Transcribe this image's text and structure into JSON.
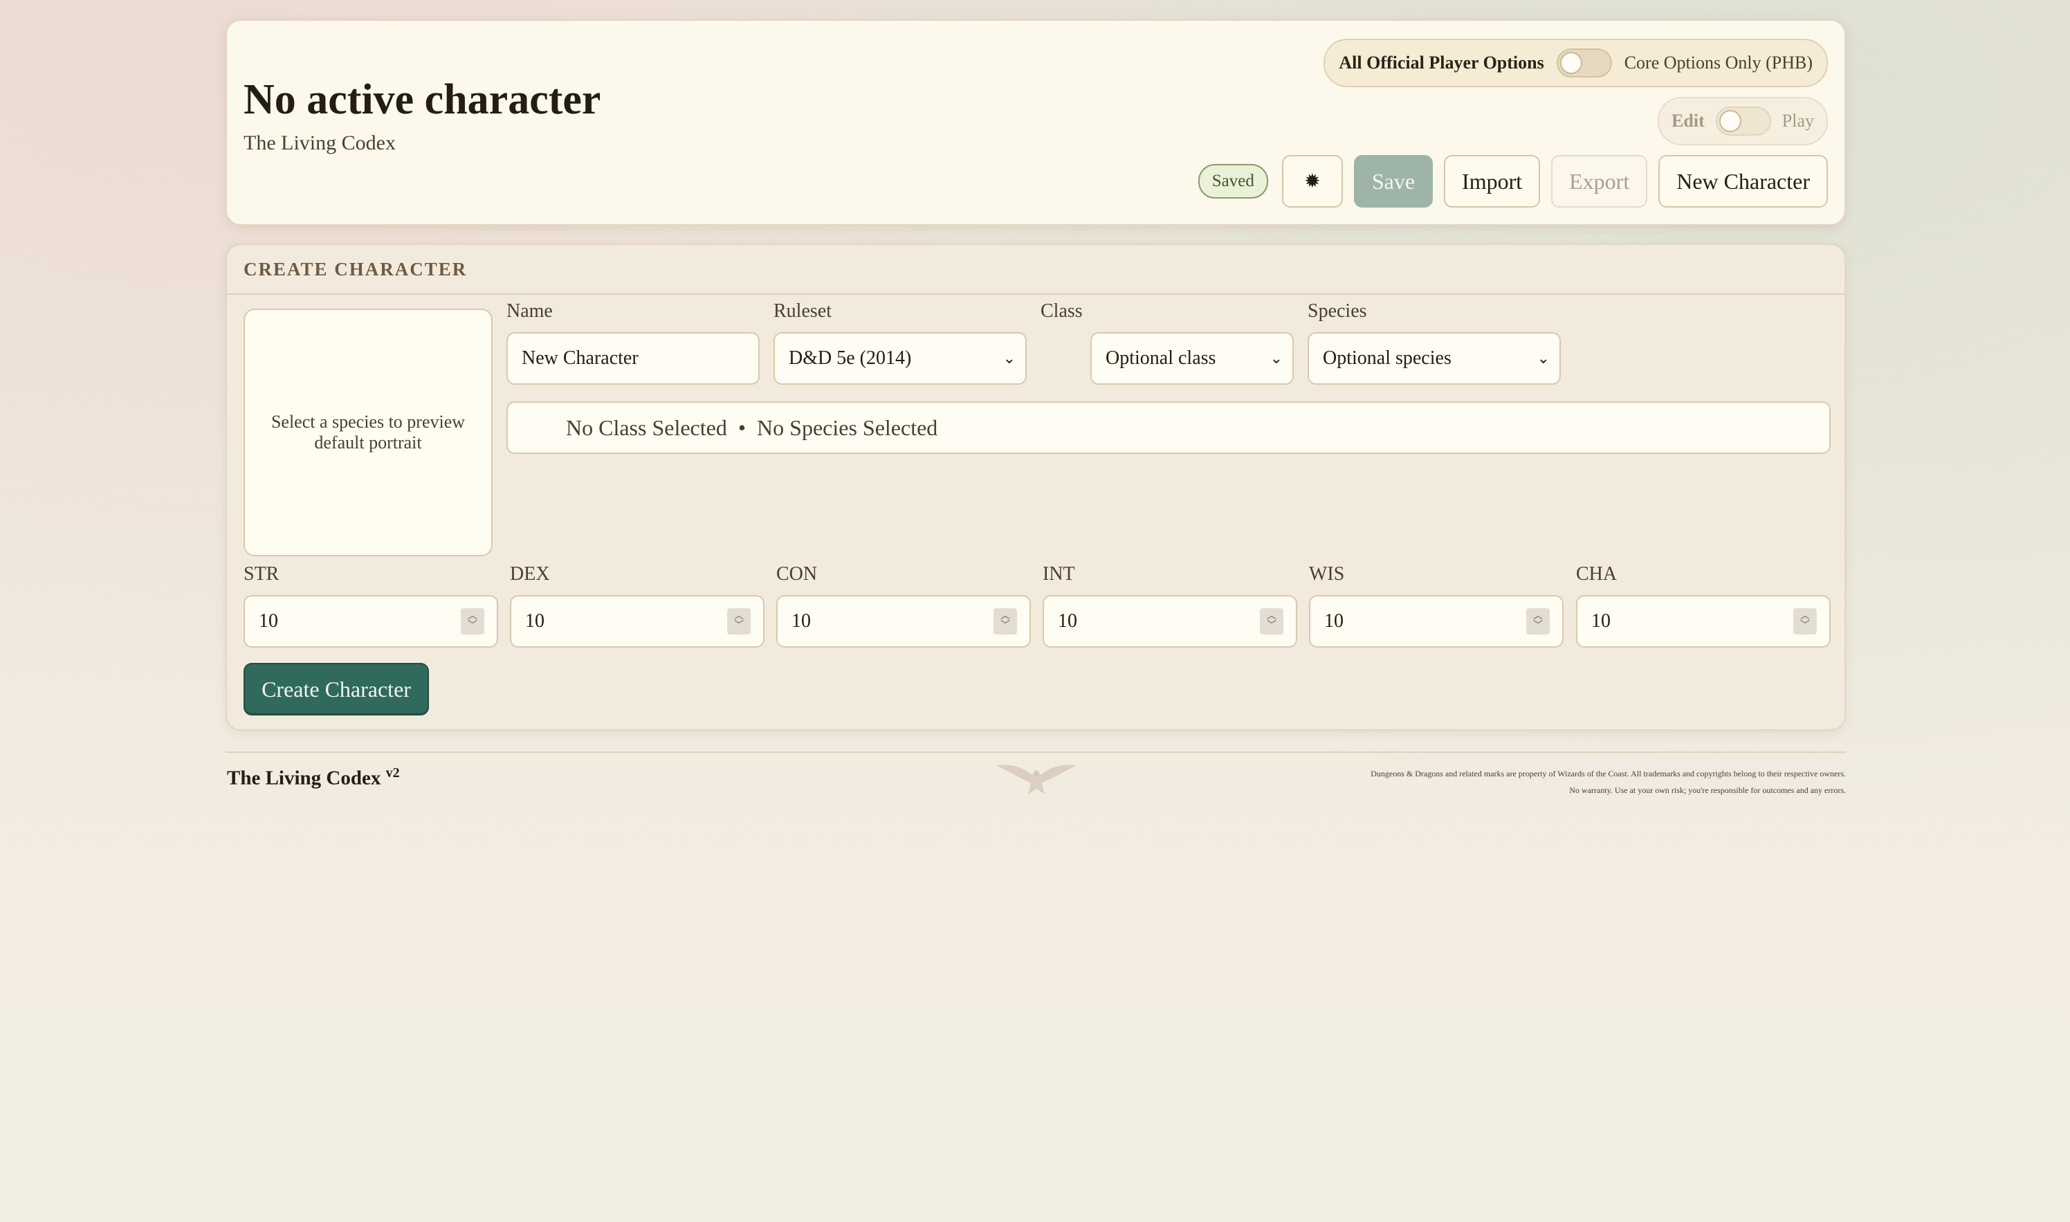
{
  "header": {
    "title": "No active character",
    "subtitle": "The Living Codex",
    "options_toggle": {
      "left_label": "All Official Player Options",
      "right_label": "Core Options Only (PHB)"
    },
    "mode_toggle": {
      "left_label": "Edit",
      "right_label": "Play"
    },
    "status_badge": "Saved",
    "settings_icon": "✹",
    "buttons": {
      "save": "Save",
      "import": "Import",
      "export": "Export",
      "new_character": "New Character"
    }
  },
  "create": {
    "section_title": "CREATE CHARACTER",
    "portrait_hint": "Select a species to preview default portrait",
    "fields": {
      "name": {
        "label": "Name",
        "value": "New Character"
      },
      "ruleset": {
        "label": "Ruleset",
        "value": "D&D 5e (2014)"
      },
      "class": {
        "label": "Class",
        "value": "Optional class"
      },
      "species": {
        "label": "Species",
        "value": "Optional species"
      }
    },
    "summary": {
      "class_text": "No Class Selected",
      "separator": "•",
      "species_text": "No Species Selected"
    },
    "stats": [
      {
        "label": "STR",
        "value": "10"
      },
      {
        "label": "DEX",
        "value": "10"
      },
      {
        "label": "CON",
        "value": "10"
      },
      {
        "label": "INT",
        "value": "10"
      },
      {
        "label": "WIS",
        "value": "10"
      },
      {
        "label": "CHA",
        "value": "10"
      }
    ],
    "create_button": "Create Character"
  },
  "footer": {
    "brand": "The Living Codex",
    "version": "v2",
    "legal_line1": "Dungeons & Dragons and related marks are property of Wizards of the Coast. All trademarks and copyrights belong to their respective owners.",
    "legal_line2": "No warranty. Use at your own risk; you're responsible for outcomes and any errors."
  },
  "colors": {
    "primary": "#2f6a5c",
    "card": "#fcf8ec",
    "save_disabled": "#9fb4a8"
  }
}
